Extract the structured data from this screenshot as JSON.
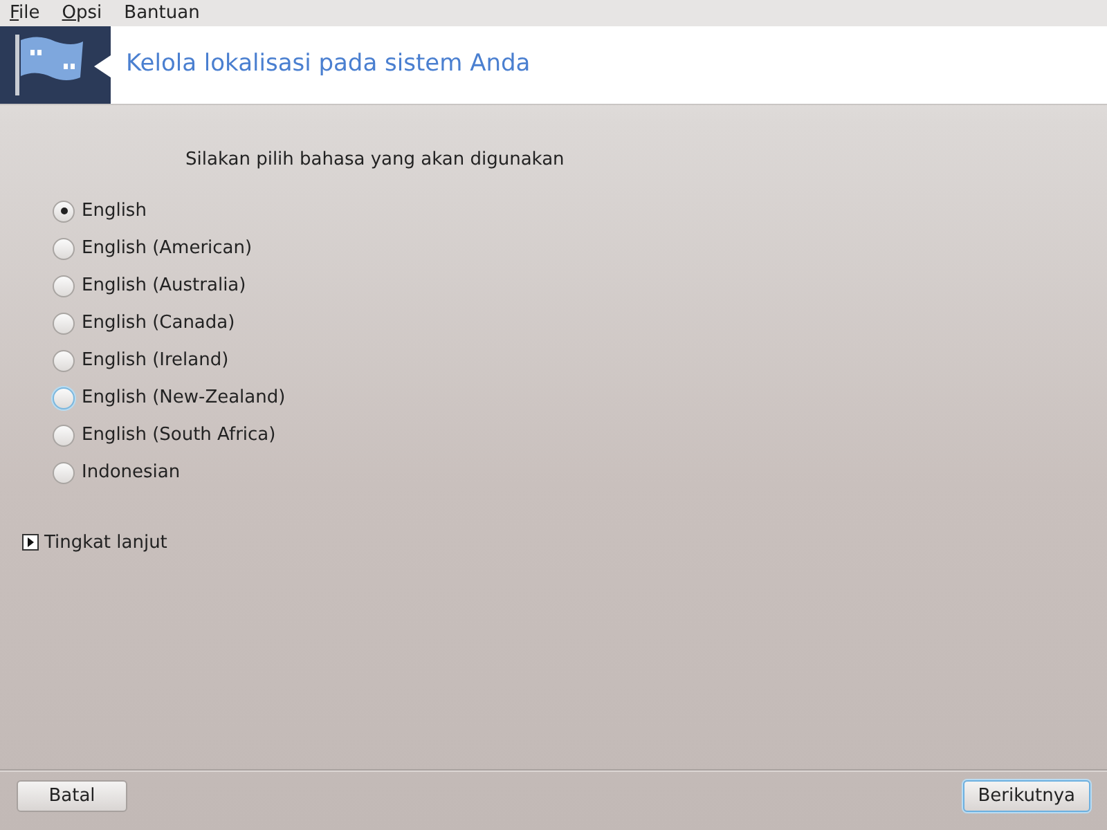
{
  "menu": [
    {
      "label": "File",
      "mnemonic_underlined": true
    },
    {
      "label": "Opsi",
      "mnemonic_underlined": true
    },
    {
      "label": "Bantuan",
      "mnemonic_underlined": false
    }
  ],
  "header": {
    "title": "Kelola lokalisasi pada sistem Anda"
  },
  "prompt": "Silakan pilih bahasa yang akan digunakan",
  "languages": [
    {
      "label": "English",
      "selected": true,
      "focused": false
    },
    {
      "label": "English (American)",
      "selected": false,
      "focused": false
    },
    {
      "label": "English (Australia)",
      "selected": false,
      "focused": false
    },
    {
      "label": "English (Canada)",
      "selected": false,
      "focused": false
    },
    {
      "label": "English (Ireland)",
      "selected": false,
      "focused": false
    },
    {
      "label": "English (New-Zealand)",
      "selected": false,
      "focused": true
    },
    {
      "label": "English (South Africa)",
      "selected": false,
      "focused": false
    },
    {
      "label": "Indonesian",
      "selected": false,
      "focused": false
    }
  ],
  "advanced": {
    "label": "Tingkat lanjut",
    "expanded": false
  },
  "buttons": [
    {
      "label": "Batal",
      "default": false
    },
    {
      "label": "Berikutnya",
      "default": true
    }
  ]
}
